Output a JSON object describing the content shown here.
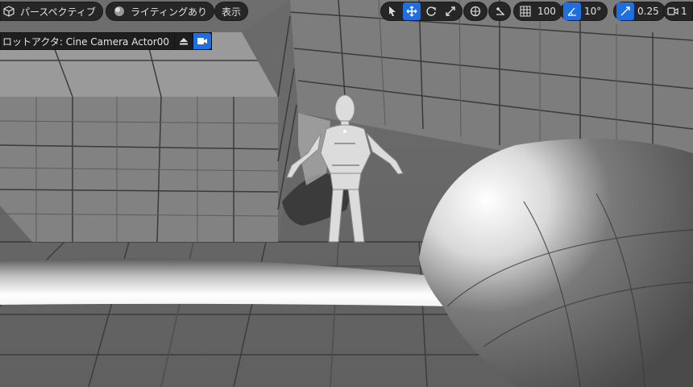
{
  "viewport": {
    "perspective_label": "パースペクティブ",
    "lighting_label": "ライティングあり",
    "show_label": "表示",
    "grid_snap_value": "100",
    "rotation_snap_value": "10°",
    "scale_snap_value": "0.25",
    "camera_speed_value": "1"
  },
  "pilot": {
    "label": "ロットアクタ: Cine Camera Actor00"
  },
  "colors": {
    "accent": "#1f6fe0",
    "toolbar_bg": "#262626",
    "floor": "#6a6a6a"
  }
}
